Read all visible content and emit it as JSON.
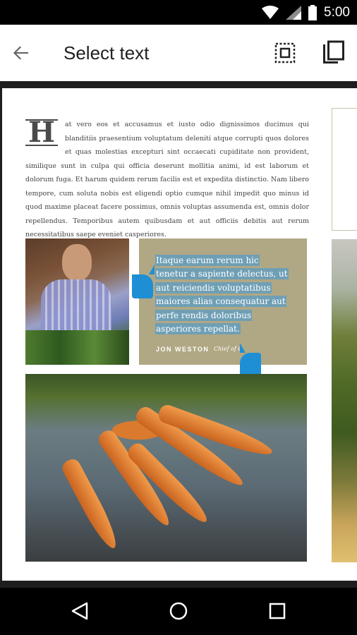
{
  "status_bar": {
    "time": "5:00",
    "icons": [
      "wifi-icon",
      "cell-signal-icon",
      "battery-icon"
    ]
  },
  "app_bar": {
    "title": "Select text",
    "back_icon": "arrow-back-icon",
    "select_all_icon": "select-all-icon",
    "copy_icon": "copy-icon"
  },
  "article": {
    "drop_cap": "H",
    "body": "at vero eos et accusamus et iusto odio dignissimos ducimus qui blanditiis praesentium voluptatum deleniti atque corrupti quos dolores et quas molestias excepturi sint occaecati cupiditate non provident, similique sunt in culpa qui officia deserunt mollitia animi, id est laborum et dolorum fuga. Et harum quidem rerum facilis est et expedita distinctio. Nam libero tempore, cum soluta nobis est eligendi optio cumque nihil impedit quo minus id quod maxime placeat facere possimus, omnis voluptas assumenda est, omnis dolor repellendus. Temporibus autem quibusdam et aut officiis debitis aut rerum necessitatibus saepe eveniet casperiores."
  },
  "quote": {
    "lines": [
      "Itaque earum rerum hic",
      "tenetur a sapiente delectus, ut",
      "aut reiciendis voluptatibus",
      "maiores alias consequatur aut",
      "perfe rendis doloribus",
      "asperiores repellat."
    ],
    "author": "JON WESTON",
    "author_title": "Chief of O"
  },
  "colors": {
    "selection": "#6f9fb5",
    "handle": "#1e8fd4",
    "quote_bg": "#b0a884"
  },
  "nav_bar": {
    "back_icon": "nav-back-icon",
    "home_icon": "nav-home-icon",
    "recents_icon": "nav-recents-icon"
  }
}
